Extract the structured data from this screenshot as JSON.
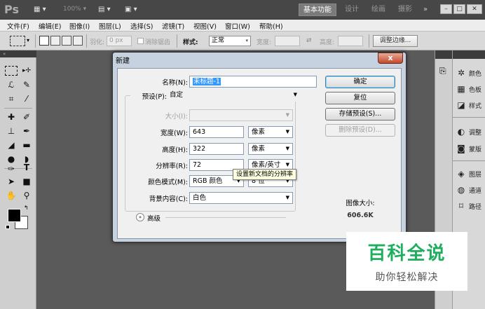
{
  "app": {
    "logo": "Ps",
    "zoom": "100%",
    "workspaces": [
      "基本功能",
      "设计",
      "绘画",
      "摄影"
    ],
    "more": "»"
  },
  "menu": [
    "文件(F)",
    "编辑(E)",
    "图像(I)",
    "图层(L)",
    "选择(S)",
    "滤镜(T)",
    "视图(V)",
    "窗口(W)",
    "帮助(H)"
  ],
  "options_bar": {
    "feather_label": "羽化:",
    "feather_value": "0 px",
    "antialias_label": "消除锯齿",
    "style_label": "样式:",
    "style_value": "正常",
    "width_label": "宽度:",
    "height_label": "高度:",
    "refine_edge_button": "调整边缘..."
  },
  "right_panel": {
    "items": [
      "颜色",
      "色板",
      "样式",
      "调整",
      "蒙版",
      "图层",
      "通道",
      "路径"
    ]
  },
  "dialog": {
    "title": "新建",
    "close": "x",
    "name_label": "名称(N):",
    "name_value": "未标题-1",
    "preset_label": "预设(P):",
    "preset_value": "自定",
    "size_label": "大小(I):",
    "width_label": "宽度(W):",
    "width_value": "643",
    "width_unit": "像素",
    "height_label": "高度(H):",
    "height_value": "322",
    "height_unit": "像素",
    "resolution_label": "分辨率(R):",
    "resolution_value": "72",
    "resolution_unit": "像素/英寸",
    "color_mode_label": "颜色模式(M):",
    "color_mode_value": "RGB 颜色",
    "color_bits_value": "8 位",
    "background_label": "背景内容(C):",
    "background_value": "白色",
    "advanced_label": "高级",
    "tooltip": "设置新文档的分辨率",
    "ok_button": "确定",
    "reset_button": "复位",
    "save_preset_button": "存储预设(S)...",
    "delete_preset_button": "删除预设(D)...",
    "image_size_label": "图像大小:",
    "image_size_value": "606.6K"
  },
  "watermark": {
    "title": "百科全说",
    "subtitle": "助你轻松解决"
  },
  "colors": {
    "accent": "#3399ff",
    "watermark_green": "#1eae5e"
  }
}
